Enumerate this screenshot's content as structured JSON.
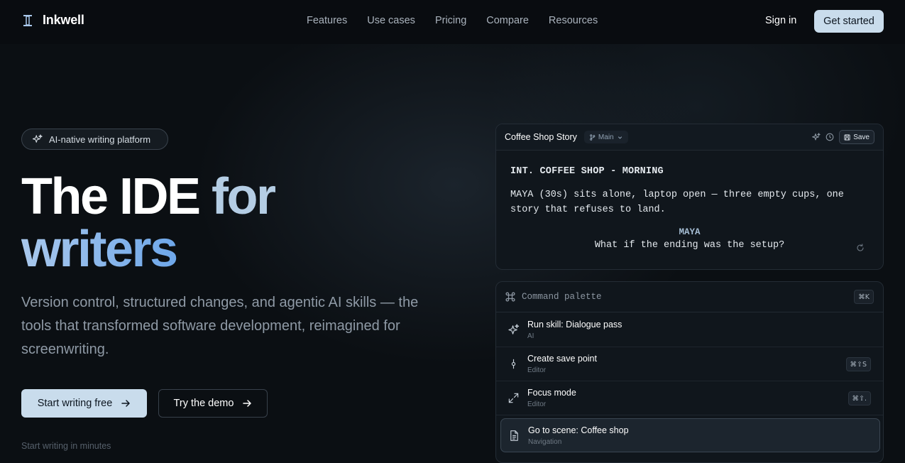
{
  "nav": {
    "brand": "Inkwell",
    "links": [
      "Features",
      "Use cases",
      "Pricing",
      "Compare",
      "Resources"
    ],
    "sign_in": "Sign in",
    "get_started": "Get started"
  },
  "hero": {
    "badge": "AI-native writing platform",
    "title_line1_a": "The IDE",
    "title_line1_b": "for",
    "title_line2": "writers",
    "subtitle": "Version control, structured changes, and agentic AI skills — the tools that transformed software development, reimagined for screenwriting.",
    "primary_cta": "Start writing free",
    "secondary_cta": "Try the demo",
    "footnote": "Start writing in minutes"
  },
  "editor": {
    "doc_title": "Coffee Shop Story",
    "branch": "Main",
    "save_label": "Save",
    "scene_heading": "INT. COFFEE SHOP - MORNING",
    "action": "MAYA (30s) sits alone, laptop open — three empty cups, one story that refuses to land.",
    "character": "MAYA",
    "dialogue": "What if the ending was the setup?"
  },
  "palette": {
    "placeholder": "Command palette",
    "shortcut": "⌘K",
    "commands": [
      {
        "label": "Run skill: Dialogue pass",
        "category": "AI",
        "shortcut": "",
        "icon": "sparkles-icon"
      },
      {
        "label": "Create save point",
        "category": "Editor",
        "shortcut": "⌘⇧S",
        "icon": "commit-icon"
      },
      {
        "label": "Focus mode",
        "category": "Editor",
        "shortcut": "⌘⇧.",
        "icon": "expand-icon"
      },
      {
        "label": "Go to scene: Coffee shop",
        "category": "Navigation",
        "shortcut": "",
        "icon": "document-icon"
      }
    ]
  },
  "colors": {
    "background": "#0b0f13",
    "accent": "#c9dcec",
    "gradient_blue": "#6ea7ea"
  }
}
